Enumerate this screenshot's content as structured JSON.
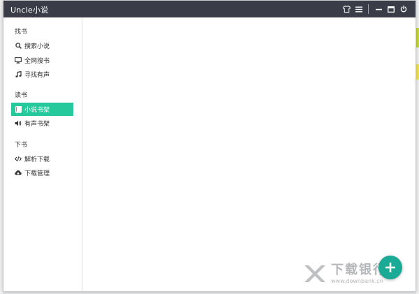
{
  "app": {
    "title": "Uncle小说"
  },
  "titlebar": {
    "buttons": [
      "shirt-icon",
      "menu-icon",
      "minimize-icon",
      "maximize-icon",
      "power-icon"
    ]
  },
  "sidebar": {
    "sections": [
      {
        "title": "找书",
        "items": [
          {
            "label": "搜索小说",
            "icon": "search-icon"
          },
          {
            "label": "全网搜书",
            "icon": "monitor-icon"
          },
          {
            "label": "寻找有声",
            "icon": "music-icon"
          }
        ]
      },
      {
        "title": "读书",
        "items": [
          {
            "label": "小说书架",
            "icon": "book-icon",
            "active": true
          },
          {
            "label": "有声书架",
            "icon": "volume-icon"
          }
        ]
      },
      {
        "title": "下书",
        "items": [
          {
            "label": "解析下载",
            "icon": "code-icon"
          },
          {
            "label": "下载管理",
            "icon": "cloud-download-icon"
          }
        ]
      }
    ]
  },
  "colors": {
    "titlebar": "#3a3d48",
    "accent": "#26c99b",
    "fab": "#1aaa95"
  },
  "watermark": {
    "cn": "下载银行",
    "en": "www.downbank.cn"
  }
}
